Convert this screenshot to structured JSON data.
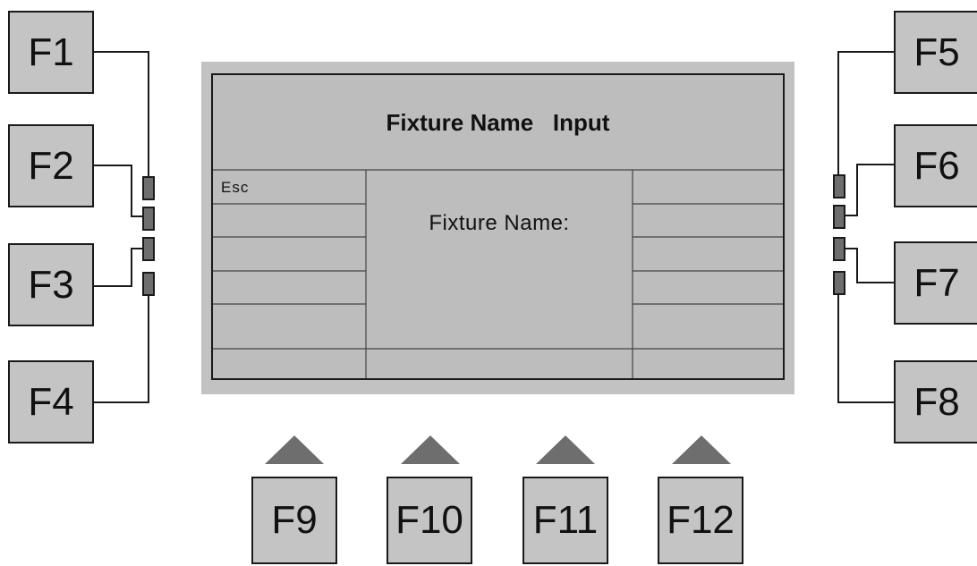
{
  "screen": {
    "title": "Fixture Name   Input",
    "left_menu": [
      "Esc",
      "",
      "",
      "",
      ""
    ],
    "center_label": "Fixture Name:"
  },
  "keys": {
    "left": [
      "F1",
      "F2",
      "F3",
      "F4"
    ],
    "right": [
      "F5",
      "F6",
      "F7",
      "F8"
    ],
    "bottom": [
      "F9",
      "F10",
      "F11",
      "F12"
    ]
  },
  "colors": {
    "key_fill": "#c4c4c4",
    "screen_fill": "#bdbdbd",
    "frame_fill": "#c2c2c2",
    "arrow_fill": "#6e6e6e",
    "line": "#1a1a1a"
  },
  "icons": {
    "bottom_arrows": "triangle-up-icon",
    "side_connectors": "connector-block-icon"
  }
}
